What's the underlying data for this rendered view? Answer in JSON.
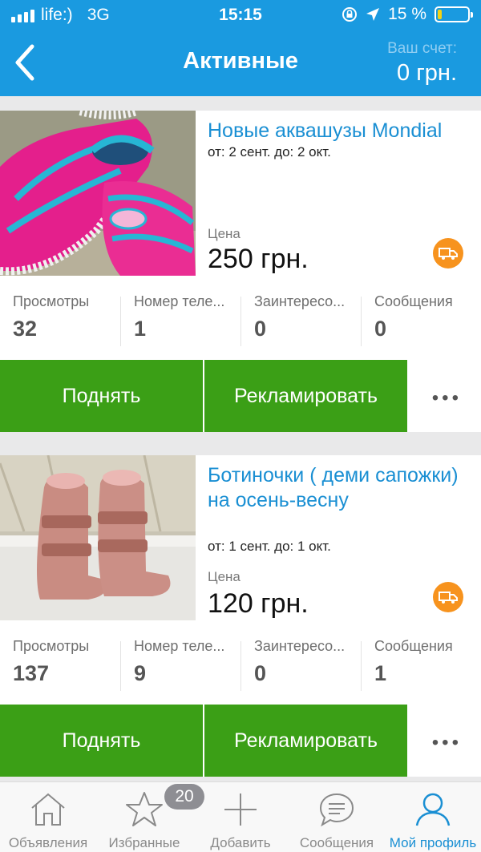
{
  "status_bar": {
    "carrier": "life:)",
    "network": "3G",
    "time": "15:15",
    "battery_percent": "15 %",
    "battery_level": 0.15
  },
  "header": {
    "title": "Активные",
    "account_label": "Ваш счет:",
    "account_value": "0 грн."
  },
  "listings": [
    {
      "title": "Новые аквашузы Mondial",
      "dates": "от: 2 сент. до: 2 окт.",
      "price_label": "Цена",
      "price": "250 грн.",
      "stats": [
        {
          "label": "Просмотры",
          "value": "32"
        },
        {
          "label": "Номер теле...",
          "value": "1"
        },
        {
          "label": "Заинтересо...",
          "value": "0"
        },
        {
          "label": "Сообщения",
          "value": "0"
        }
      ],
      "raise_label": "Поднять",
      "promote_label": "Рекламировать"
    },
    {
      "title": "Ботиночки ( деми сапожки) на осень-весну",
      "dates": "от: 1 сент. до: 1 окт.",
      "price_label": "Цена",
      "price": "120 грн.",
      "stats": [
        {
          "label": "Просмотры",
          "value": "137"
        },
        {
          "label": "Номер теле...",
          "value": "9"
        },
        {
          "label": "Заинтересо...",
          "value": "0"
        },
        {
          "label": "Сообщения",
          "value": "1"
        }
      ],
      "raise_label": "Поднять",
      "promote_label": "Рекламировать"
    }
  ],
  "tabbar": {
    "items": [
      {
        "label": "Объявления",
        "icon": "home-icon"
      },
      {
        "label": "Избранные",
        "icon": "star-icon"
      },
      {
        "label": "Добавить",
        "icon": "plus-icon"
      },
      {
        "label": "Сообщения",
        "icon": "chat-icon"
      },
      {
        "label": "Мой профиль",
        "icon": "profile-icon"
      }
    ],
    "favorites_badge": "20",
    "active": "Мой профиль"
  },
  "colors": {
    "header_blue": "#1a9ae0",
    "link_blue": "#1a8fd3",
    "button_green": "#3b9f16",
    "delivery_orange": "#f7931e"
  }
}
